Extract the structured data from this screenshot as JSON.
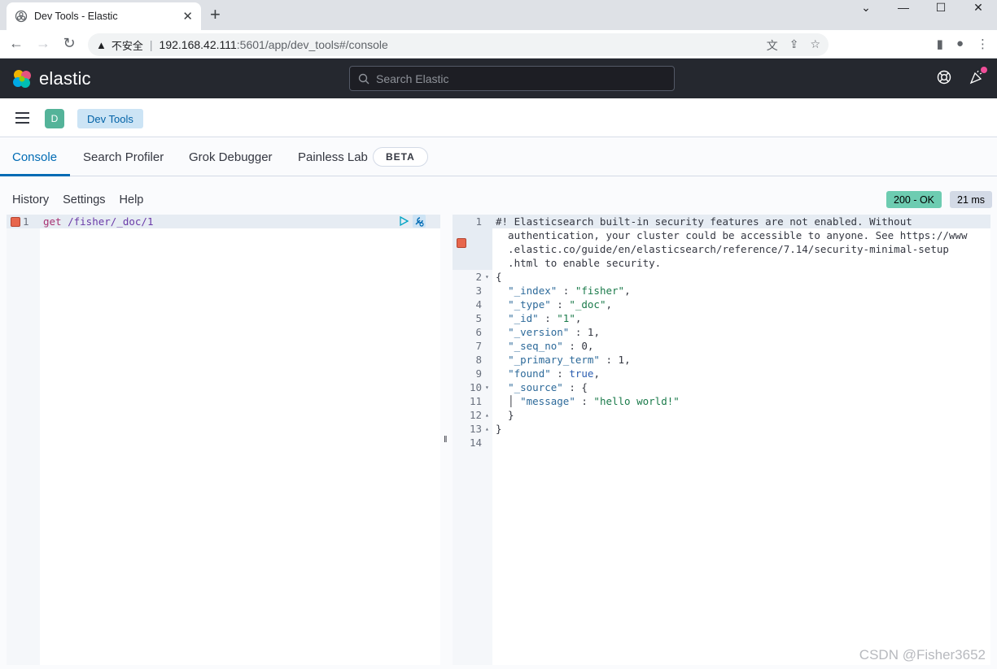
{
  "browser": {
    "tab_title": "Dev Tools - Elastic",
    "close_glyph": "✕",
    "newtab_glyph": "+",
    "url_security": "不安全",
    "url_host": "192.168.42.111",
    "url_path": ":5601/app/dev_tools#/console"
  },
  "kibana": {
    "brand": "elastic",
    "search_placeholder": "Search Elastic",
    "space_initial": "D",
    "breadcrumb": "Dev Tools"
  },
  "devtools": {
    "tabs": [
      "Console",
      "Search Profiler",
      "Grok Debugger",
      "Painless Lab"
    ],
    "beta_badge": "BETA"
  },
  "console": {
    "menu": [
      "History",
      "Settings",
      "Help"
    ],
    "status": "200 - OK",
    "timing": "21 ms",
    "request": {
      "line_number": "1",
      "method": "get",
      "path": "/fisher/_doc/1"
    },
    "response_warning": [
      "#! Elasticsearch built-in security features are not enabled. Without",
      "  authentication, your cluster could be accessible to anyone. See https://www",
      "  .elastic.co/guide/en/elasticsearch/reference/7.14/security-minimal-setup",
      "  .html to enable security."
    ],
    "response_lines": [
      {
        "n": "2",
        "fold": "▾",
        "text": "{"
      },
      {
        "n": "3",
        "fold": "",
        "key": "\"_index\"",
        "val": "\"fisher\"",
        "vt": "s",
        "tail": ",",
        "indent": "  "
      },
      {
        "n": "4",
        "fold": "",
        "key": "\"_type\"",
        "val": "\"_doc\"",
        "vt": "s",
        "tail": ",",
        "indent": "  "
      },
      {
        "n": "5",
        "fold": "",
        "key": "\"_id\"",
        "val": "\"1\"",
        "vt": "s",
        "tail": ",",
        "indent": "  "
      },
      {
        "n": "6",
        "fold": "",
        "key": "\"_version\"",
        "val": "1",
        "vt": "n",
        "tail": ",",
        "indent": "  "
      },
      {
        "n": "7",
        "fold": "",
        "key": "\"_seq_no\"",
        "val": "0",
        "vt": "n",
        "tail": ",",
        "indent": "  "
      },
      {
        "n": "8",
        "fold": "",
        "key": "\"_primary_term\"",
        "val": "1",
        "vt": "n",
        "tail": ",",
        "indent": "  "
      },
      {
        "n": "9",
        "fold": "",
        "key": "\"found\"",
        "val": "true",
        "vt": "b",
        "tail": ",",
        "indent": "  "
      },
      {
        "n": "10",
        "fold": "▾",
        "key": "\"_source\"",
        "val": "{",
        "vt": "n",
        "tail": "",
        "indent": "  "
      },
      {
        "n": "11",
        "fold": "",
        "key": "\"message\"",
        "val": "\"hello world!\"",
        "vt": "s",
        "tail": "",
        "indent": "  │ "
      },
      {
        "n": "12",
        "fold": "▴",
        "text": "  }"
      },
      {
        "n": "13",
        "fold": "▴",
        "text": "}"
      },
      {
        "n": "14",
        "fold": "",
        "text": ""
      }
    ]
  },
  "watermark": "CSDN @Fisher3652"
}
